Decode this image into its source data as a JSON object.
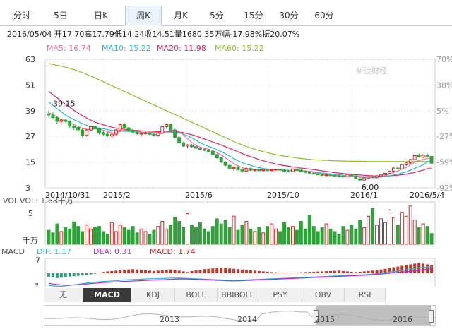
{
  "tabs": [
    {
      "label": "分时",
      "active": false
    },
    {
      "label": "5日",
      "active": false
    },
    {
      "label": "日K",
      "active": false
    },
    {
      "label": "周K",
      "active": true
    },
    {
      "label": "月K",
      "active": false
    },
    {
      "label": "5分",
      "active": false
    },
    {
      "label": "15分",
      "active": false
    },
    {
      "label": "30分",
      "active": false
    },
    {
      "label": "60分",
      "active": false
    }
  ],
  "info_line": "2016/05/04 开17.70高17.79低14.24收14.51量1680.35万幅-17.98%振20.07%",
  "ma": [
    {
      "label": "MA5: 16.74",
      "color": "#f06fa0"
    },
    {
      "label": "MA10: 15.22",
      "color": "#26b7d7"
    },
    {
      "label": "MA20: 11.98",
      "color": "#e0245e"
    },
    {
      "label": "MA60: 15.22",
      "color": "#8cbf26"
    }
  ],
  "watermark": "新浪财经",
  "chart_data": {
    "type": "candlestick",
    "price_ticks": [
      "63",
      "51",
      "39",
      "27",
      "15",
      "3"
    ],
    "pct_ticks": [
      "70%",
      "38%",
      "5%",
      "-27%",
      "-59%",
      "-92%"
    ],
    "x_labels": [
      "2014/10/31",
      "2015/2",
      "2015/6",
      "2015/10",
      "2016/1",
      "2016/5/4"
    ],
    "high_label": "39.15",
    "low_label": "6.00",
    "ylim": [
      3,
      63
    ],
    "candles": [
      [
        37.5,
        39.15,
        36.0,
        37.0
      ],
      [
        37.0,
        38.5,
        35.0,
        35.8
      ],
      [
        35.8,
        36.5,
        33.0,
        34.0
      ],
      [
        34.0,
        35.0,
        32.5,
        34.6
      ],
      [
        34.6,
        35.2,
        33.5,
        34.0
      ],
      [
        34.0,
        34.5,
        31.0,
        31.8
      ],
      [
        31.8,
        32.5,
        30.0,
        31.2
      ],
      [
        31.2,
        33.0,
        29.0,
        30.0
      ],
      [
        30.0,
        31.0,
        26.5,
        27.5
      ],
      [
        27.5,
        30.5,
        27.0,
        30.0
      ],
      [
        30.0,
        32.0,
        29.5,
        31.5
      ],
      [
        31.5,
        32.0,
        30.0,
        30.5
      ],
      [
        30.5,
        31.0,
        28.0,
        28.8
      ],
      [
        28.8,
        29.5,
        27.5,
        28.0
      ],
      [
        28.0,
        29.0,
        26.8,
        27.2
      ],
      [
        27.2,
        28.5,
        26.5,
        28.0
      ],
      [
        28.0,
        30.5,
        27.5,
        30.0
      ],
      [
        30.0,
        33.0,
        29.5,
        32.5
      ],
      [
        32.5,
        33.2,
        30.5,
        31.0
      ],
      [
        31.0,
        31.5,
        29.0,
        29.8
      ],
      [
        29.8,
        30.5,
        28.5,
        29.0
      ],
      [
        29.0,
        29.6,
        27.8,
        28.2
      ],
      [
        28.2,
        28.8,
        27.0,
        28.4
      ],
      [
        28.4,
        29.2,
        27.8,
        28.6
      ],
      [
        28.6,
        29.0,
        27.5,
        28.0
      ],
      [
        28.0,
        28.5,
        27.0,
        27.5
      ],
      [
        27.5,
        28.8,
        27.0,
        28.5
      ],
      [
        28.5,
        32.0,
        28.0,
        31.5
      ],
      [
        31.5,
        33.0,
        30.5,
        32.5
      ],
      [
        32.5,
        33.0,
        29.5,
        30.0
      ],
      [
        30.0,
        30.5,
        26.0,
        26.5
      ],
      [
        26.5,
        27.0,
        23.5,
        24.0
      ],
      [
        24.0,
        24.5,
        22.0,
        22.5
      ],
      [
        22.5,
        23.5,
        21.5,
        23.0
      ],
      [
        23.0,
        23.5,
        21.8,
        22.2
      ],
      [
        22.2,
        22.8,
        21.0,
        21.5
      ],
      [
        21.5,
        22.0,
        20.5,
        21.0
      ],
      [
        21.0,
        21.8,
        20.0,
        20.5
      ],
      [
        20.5,
        21.0,
        19.5,
        20.0
      ],
      [
        20.0,
        20.5,
        18.0,
        18.5
      ],
      [
        18.5,
        19.0,
        16.5,
        17.0
      ],
      [
        17.0,
        17.5,
        14.5,
        15.0
      ],
      [
        15.0,
        15.5,
        13.0,
        13.5
      ],
      [
        13.5,
        14.0,
        11.5,
        12.0
      ],
      [
        12.0,
        13.0,
        11.0,
        12.5
      ],
      [
        12.5,
        13.5,
        11.0,
        11.5
      ],
      [
        11.5,
        12.0,
        10.0,
        10.8
      ],
      [
        10.8,
        12.5,
        10.5,
        12.0
      ],
      [
        12.0,
        12.5,
        10.8,
        11.2
      ],
      [
        11.2,
        11.8,
        10.5,
        11.5
      ],
      [
        11.5,
        12.0,
        10.8,
        11.0
      ],
      [
        11.0,
        11.5,
        10.5,
        11.3
      ],
      [
        11.3,
        11.8,
        10.8,
        11.0
      ],
      [
        11.0,
        11.6,
        10.6,
        11.4
      ],
      [
        11.4,
        12.0,
        11.0,
        11.6
      ],
      [
        11.6,
        12.2,
        11.0,
        11.2
      ],
      [
        11.2,
        11.6,
        10.5,
        10.8
      ],
      [
        10.8,
        11.2,
        10.2,
        10.6
      ],
      [
        10.6,
        12.0,
        10.4,
        11.8
      ],
      [
        11.8,
        12.4,
        11.0,
        11.2
      ],
      [
        11.2,
        11.6,
        10.4,
        10.6
      ],
      [
        10.6,
        11.0,
        9.8,
        10.2
      ],
      [
        10.2,
        10.6,
        9.5,
        9.8
      ],
      [
        9.8,
        10.2,
        9.0,
        9.4
      ],
      [
        9.4,
        9.8,
        8.8,
        9.2
      ],
      [
        9.2,
        9.6,
        8.6,
        8.8
      ],
      [
        8.8,
        9.4,
        8.4,
        9.0
      ],
      [
        9.0,
        9.4,
        8.6,
        8.8
      ],
      [
        8.8,
        9.2,
        8.4,
        8.6
      ],
      [
        8.6,
        9.0,
        8.0,
        8.4
      ],
      [
        8.4,
        8.8,
        7.8,
        8.2
      ],
      [
        8.2,
        9.5,
        8.0,
        9.2
      ],
      [
        9.2,
        9.6,
        8.4,
        8.6
      ],
      [
        8.6,
        8.8,
        7.0,
        7.2
      ],
      [
        7.2,
        7.6,
        6.0,
        6.6
      ],
      [
        6.6,
        7.8,
        6.4,
        7.6
      ],
      [
        7.6,
        8.4,
        7.2,
        8.2
      ],
      [
        8.2,
        8.6,
        7.6,
        8.0
      ],
      [
        8.0,
        8.8,
        7.8,
        8.6
      ],
      [
        8.6,
        9.4,
        8.4,
        9.2
      ],
      [
        9.2,
        10.0,
        9.0,
        9.8
      ],
      [
        9.8,
        11.0,
        9.6,
        10.8
      ],
      [
        10.8,
        12.5,
        10.5,
        12.2
      ],
      [
        12.2,
        13.0,
        11.5,
        11.8
      ],
      [
        11.8,
        14.0,
        11.6,
        13.8
      ],
      [
        13.8,
        15.0,
        13.2,
        14.6
      ],
      [
        14.6,
        16.5,
        14.2,
        16.2
      ],
      [
        16.2,
        18.5,
        15.8,
        18.0
      ],
      [
        18.0,
        19.0,
        17.0,
        17.4
      ],
      [
        17.4,
        18.6,
        16.8,
        18.2
      ],
      [
        18.2,
        19.2,
        17.2,
        17.7
      ],
      [
        17.7,
        17.79,
        14.24,
        14.51
      ]
    ],
    "ma_lines": {
      "ma5": [
        38.0,
        37.2,
        36.0,
        34.8,
        34.4,
        33.5,
        32.5,
        31.6,
        30.8,
        30.3,
        30.2,
        30.6,
        30.5,
        29.8,
        29.2,
        28.7,
        28.6,
        29.2,
        29.9,
        29.9,
        29.7,
        29.6,
        29.1,
        28.6,
        28.2,
        27.9,
        27.9,
        28.6,
        29.3,
        29.8,
        30.0,
        29.3,
        27.7,
        26.0,
        24.2,
        22.8,
        22.0,
        21.5,
        21.0,
        20.3,
        19.4,
        18.3,
        17.0,
        15.6,
        14.3,
        13.3,
        12.4,
        11.9,
        11.6,
        11.4,
        11.4,
        11.4,
        11.3,
        11.2,
        11.3,
        11.3,
        11.2,
        11.0,
        11.0,
        11.0,
        10.9,
        10.8,
        10.6,
        10.3,
        9.8,
        9.4,
        9.1,
        8.9,
        8.8,
        8.6,
        8.4,
        8.6,
        8.6,
        8.3,
        7.9,
        7.8,
        7.7,
        7.6,
        7.6,
        8.1,
        8.8,
        9.4,
        10.2,
        10.8,
        11.7,
        12.5,
        13.8,
        15.0,
        15.7,
        16.2,
        16.74,
        16.74
      ],
      "ma10": [
        43.0,
        41.5,
        40.0,
        38.5,
        37.0,
        35.8,
        34.8,
        33.9,
        33.0,
        32.2,
        31.6,
        31.2,
        30.9,
        30.6,
        30.2,
        29.8,
        29.5,
        29.4,
        29.4,
        29.4,
        29.3,
        29.1,
        28.9,
        28.8,
        28.8,
        28.8,
        28.8,
        28.9,
        29.0,
        29.0,
        28.9,
        28.6,
        28.1,
        27.3,
        26.3,
        25.2,
        24.1,
        23.1,
        22.3,
        21.6,
        20.8,
        19.9,
        18.9,
        17.8,
        16.6,
        15.6,
        14.7,
        14.0,
        13.5,
        12.9,
        12.4,
        12.0,
        11.8,
        11.6,
        11.5,
        11.4,
        11.3,
        11.2,
        11.1,
        11.1,
        11.0,
        10.9,
        10.7,
        10.5,
        10.2,
        9.9,
        9.7,
        9.5,
        9.3,
        9.1,
        8.9,
        8.8,
        8.7,
        8.5,
        8.3,
        8.2,
        8.1,
        8.0,
        8.0,
        8.2,
        8.4,
        8.6,
        9.0,
        9.4,
        9.9,
        10.4,
        11.2,
        12.1,
        12.9,
        13.7,
        15.22,
        15.22
      ],
      "ma20": [
        48.0,
        46.5,
        45.0,
        43.5,
        42.0,
        40.6,
        39.2,
        37.9,
        36.7,
        35.6,
        34.6,
        33.7,
        33.0,
        32.4,
        31.8,
        31.3,
        30.9,
        30.6,
        30.3,
        30.1,
        29.9,
        29.8,
        29.6,
        29.5,
        29.4,
        29.3,
        29.2,
        29.2,
        29.2,
        29.2,
        29.1,
        29.0,
        28.7,
        28.3,
        27.8,
        27.2,
        26.5,
        25.8,
        25.1,
        24.4,
        23.7,
        23.0,
        22.2,
        21.4,
        20.6,
        19.8,
        19.0,
        18.2,
        17.5,
        16.9,
        16.2,
        15.6,
        15.1,
        14.6,
        14.1,
        13.7,
        13.4,
        13.1,
        12.8,
        12.5,
        12.2,
        12.0,
        11.7,
        11.5,
        11.2,
        10.9,
        10.6,
        10.4,
        10.1,
        9.9,
        9.7,
        9.5,
        9.3,
        9.1,
        9.0,
        8.8,
        8.7,
        8.6,
        8.5,
        8.5,
        8.5,
        8.6,
        8.7,
        8.9,
        9.1,
        9.4,
        9.8,
        10.2,
        10.7,
        11.2,
        11.98,
        11.98
      ],
      "ma60": [
        61.0,
        60.6,
        60.2,
        59.8,
        59.3,
        58.8,
        58.2,
        57.5,
        56.8,
        56.0,
        55.2,
        54.3,
        53.4,
        52.5,
        51.6,
        50.7,
        49.8,
        48.9,
        48.0,
        47.1,
        46.2,
        45.3,
        44.4,
        43.5,
        42.6,
        41.7,
        40.8,
        39.9,
        39.0,
        38.1,
        37.2,
        36.3,
        35.4,
        34.5,
        33.6,
        32.7,
        31.8,
        30.9,
        30.0,
        29.1,
        28.2,
        27.3,
        26.4,
        25.5,
        24.6,
        23.8,
        23.0,
        22.3,
        21.6,
        21.0,
        20.4,
        19.9,
        19.4,
        18.9,
        18.5,
        18.1,
        17.8,
        17.5,
        17.2,
        16.9,
        16.7,
        16.5,
        16.3,
        16.1,
        16.0,
        15.9,
        15.8,
        15.7,
        15.6,
        15.55,
        15.5,
        15.45,
        15.4,
        15.38,
        15.35,
        15.33,
        15.3,
        15.28,
        15.26,
        15.25,
        15.24,
        15.23,
        15.22,
        15.22,
        15.22,
        15.22,
        15.22,
        15.22,
        15.22,
        15.22,
        15.22,
        15.22
      ]
    }
  },
  "vol": {
    "title": "VOL",
    "value_label": "VOL: 1.68千万",
    "ticks": [
      "5",
      "千万"
    ],
    "values": [
      2.2,
      1.8,
      3.2,
      2.0,
      2.6,
      2.4,
      3.5,
      2.8,
      2.0,
      3.0,
      2.4,
      2.6,
      2.8,
      2.0,
      1.6,
      3.4,
      2.0,
      3.0,
      2.6,
      2.2,
      2.8,
      1.8,
      2.4,
      2.0,
      1.6,
      2.2,
      2.8,
      3.6,
      2.4,
      3.0,
      4.2,
      3.6,
      2.6,
      4.8,
      3.0,
      2.6,
      3.4,
      2.4,
      2.0,
      2.8,
      4.0,
      3.2,
      3.8,
      2.6,
      4.4,
      2.2,
      3.0,
      3.6,
      2.4,
      2.0,
      2.6,
      1.8,
      2.8,
      3.2,
      2.4,
      2.0,
      3.4,
      2.6,
      2.8,
      2.2,
      3.6,
      2.4,
      4.6,
      2.8,
      2.0,
      2.6,
      3.2,
      2.4,
      2.0,
      1.6,
      2.8,
      2.2,
      3.0,
      2.4,
      3.8,
      2.6,
      4.4,
      5.6,
      3.0,
      4.0,
      3.4,
      5.4,
      4.2,
      3.0,
      5.0,
      4.4,
      6.0,
      3.8,
      2.6,
      3.2,
      2.8,
      1.68
    ]
  },
  "macd": {
    "title": "MACD",
    "labels": [
      {
        "label": "DIF: 1.17",
        "color": "#26b7d7"
      },
      {
        "label": "DEA: 0.31",
        "color": "#c026d3"
      },
      {
        "label": "MACD: 1.74",
        "color": "#e02020"
      }
    ],
    "ticks": [
      "7",
      "-7"
    ],
    "hist": [
      -1.8,
      -2.2,
      -2.6,
      -2.4,
      -2.0,
      -1.8,
      -1.6,
      -1.4,
      -1.2,
      -1.0,
      -0.6,
      -0.3,
      0.2,
      0.6,
      1.0,
      1.2,
      1.4,
      1.6,
      1.8,
      2.0,
      2.2,
      2.0,
      1.8,
      1.6,
      1.4,
      1.2,
      1.4,
      1.6,
      1.8,
      2.0,
      1.8,
      1.4,
      1.0,
      0.6,
      1.2,
      1.6,
      1.8,
      2.2,
      2.4,
      2.6,
      2.8,
      3.0,
      2.8,
      2.6,
      2.4,
      2.2,
      2.0,
      1.8,
      1.6,
      1.4,
      1.2,
      1.0,
      0.8,
      0.6,
      0.5,
      0.4,
      0.3,
      0.2,
      0.3,
      0.4,
      0.5,
      0.6,
      0.7,
      0.8,
      0.9,
      1.0,
      1.1,
      1.2,
      1.3,
      1.4,
      1.2,
      1.0,
      0.8,
      0.6,
      0.8,
      1.0,
      1.2,
      1.4,
      1.6,
      2.0,
      2.4,
      2.8,
      3.2,
      3.6,
      4.0,
      4.4,
      4.8,
      5.2,
      5.6,
      5.2,
      4.8,
      4.4
    ],
    "dif": [
      -6.5,
      -6.8,
      -7.0,
      -7.0,
      -6.8,
      -6.5,
      -6.2,
      -5.9,
      -5.6,
      -5.3,
      -5.0,
      -4.8,
      -4.6,
      -4.4,
      -4.3,
      -4.2,
      -4.0,
      -3.8,
      -3.6,
      -3.5,
      -3.4,
      -3.3,
      -3.2,
      -3.1,
      -3.0,
      -3.0,
      -2.9,
      -2.8,
      -2.7,
      -2.6,
      -2.6,
      -2.6,
      -2.7,
      -2.8,
      -2.9,
      -3.0,
      -3.1,
      -3.2,
      -3.3,
      -3.4,
      -3.5,
      -3.6,
      -3.7,
      -3.8,
      -3.8,
      -3.8,
      -3.7,
      -3.6,
      -3.5,
      -3.4,
      -3.3,
      -3.2,
      -3.1,
      -3.0,
      -2.9,
      -2.8,
      -2.7,
      -2.6,
      -2.5,
      -2.4,
      -2.3,
      -2.2,
      -2.1,
      -2.0,
      -1.9,
      -1.8,
      -1.7,
      -1.6,
      -1.5,
      -1.4,
      -1.3,
      -1.2,
      -1.1,
      -1.0,
      -0.9,
      -0.8,
      -0.6,
      -0.4,
      -0.2,
      0.0,
      0.3,
      0.6,
      0.9,
      1.2,
      1.5,
      1.8,
      2.2,
      2.6,
      3.0,
      3.2,
      3.4,
      3.6
    ],
    "dea": [
      -5.5,
      -5.8,
      -6.1,
      -6.3,
      -6.4,
      -6.4,
      -6.3,
      -6.2,
      -6.0,
      -5.8,
      -5.6,
      -5.4,
      -5.2,
      -5.0,
      -4.9,
      -4.8,
      -4.7,
      -4.5,
      -4.4,
      -4.3,
      -4.2,
      -4.1,
      -4.0,
      -3.9,
      -3.8,
      -3.7,
      -3.6,
      -3.5,
      -3.4,
      -3.3,
      -3.2,
      -3.1,
      -3.1,
      -3.1,
      -3.2,
      -3.3,
      -3.4,
      -3.5,
      -3.6,
      -3.7,
      -3.8,
      -3.9,
      -4.0,
      -4.1,
      -4.1,
      -4.1,
      -4.0,
      -3.9,
      -3.8,
      -3.7,
      -3.6,
      -3.5,
      -3.4,
      -3.3,
      -3.2,
      -3.1,
      -3.0,
      -2.9,
      -2.8,
      -2.7,
      -2.6,
      -2.5,
      -2.4,
      -2.3,
      -2.2,
      -2.1,
      -2.0,
      -1.9,
      -1.8,
      -1.7,
      -1.6,
      -1.5,
      -1.4,
      -1.3,
      -1.2,
      -1.1,
      -1.0,
      -0.8,
      -0.6,
      -0.4,
      -0.2,
      0.0,
      0.2,
      0.4,
      0.6,
      0.8,
      1.0,
      1.3,
      1.6,
      1.9,
      2.2,
      2.4
    ]
  },
  "indicator_tabs": [
    {
      "label": "无",
      "active": false
    },
    {
      "label": "MACD",
      "active": true
    },
    {
      "label": "KDJ",
      "active": false
    },
    {
      "label": "BOLL",
      "active": false
    },
    {
      "label": "BBIBOLL",
      "active": false
    },
    {
      "label": "PSY",
      "active": false
    },
    {
      "label": "OBV",
      "active": false
    },
    {
      "label": "RSI",
      "active": false
    }
  ],
  "nav_arrows": [
    "▲",
    "▼"
  ],
  "navigator_years": [
    "2013",
    "2014",
    "2015",
    "2016"
  ]
}
